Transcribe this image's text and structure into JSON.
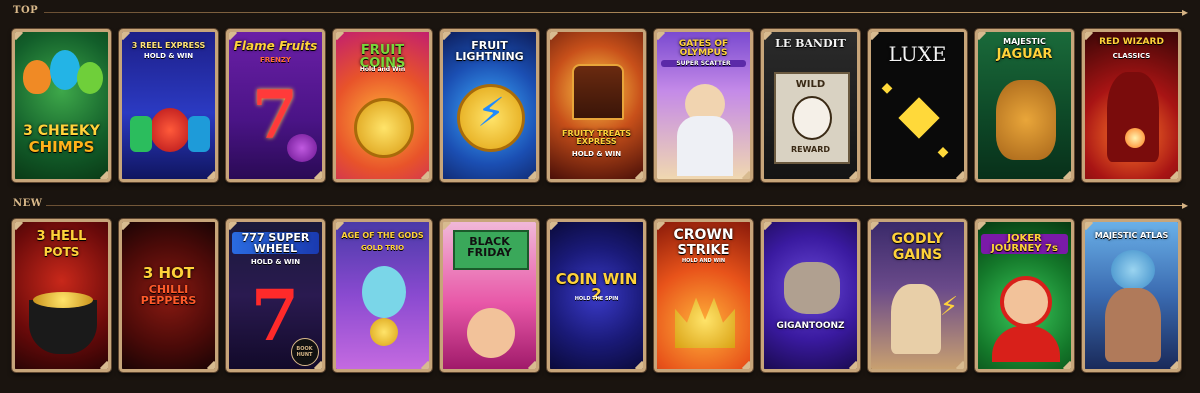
{
  "sections": {
    "top": {
      "label": "TOP"
    },
    "new": {
      "label": "NEW"
    }
  },
  "top_games": [
    {
      "title": "3 CHEEKY CHIMPS",
      "line1": "3 CHEEKY",
      "line2": "CHIMPS"
    },
    {
      "title": "3 REEL EXPRESS",
      "subtitle": "HOLD & WIN"
    },
    {
      "title": "Flame Fruits",
      "subtitle": "FRENZY"
    },
    {
      "title": "FRUIT COINS",
      "subtitle": "Hold and Win"
    },
    {
      "title": "FRUIT LIGHTNING"
    },
    {
      "title": "FRUITY TREATS EXPRESS",
      "subtitle": "HOLD & WIN"
    },
    {
      "title": "GATES OF OLYMPUS",
      "subtitle": "SUPER SCATTER"
    },
    {
      "title": "LE BANDIT",
      "sign_top": "WILD",
      "sign_bottom": "REWARD"
    },
    {
      "title": "LUXE"
    },
    {
      "title": "MAJESTIC",
      "title2": "JAGUAR"
    },
    {
      "title": "RED WIZARD",
      "subtitle": "CLASSICS"
    }
  ],
  "new_games": [
    {
      "title": "3 HELL",
      "title2": "POTS"
    },
    {
      "title": "3 HOT",
      "title2": "CHILLI PEPPERS"
    },
    {
      "title": "777 SUPER WHEEL",
      "subtitle": "HOLD & WIN",
      "badge": "BOOK HUNT"
    },
    {
      "title": "AGE OF THE GODS",
      "subtitle": "GOLD TRIO"
    },
    {
      "title": "BLACK FRIDAY"
    },
    {
      "title": "COIN WIN 2",
      "subtitle": "HOLD THE SPIN"
    },
    {
      "title": "CROWN",
      "title2": "STRIKE",
      "subtitle": "HOLD AND WIN"
    },
    {
      "title": "GIGANTOONZ"
    },
    {
      "title": "GODLY",
      "title2": "GAINS"
    },
    {
      "title": "JOKER JOURNEY 7s"
    },
    {
      "title": "MAJESTIC ATLAS"
    }
  ],
  "colors": {
    "background": "#1a140f",
    "frame": "#c7a57a",
    "section_label": "#d9b98a"
  }
}
